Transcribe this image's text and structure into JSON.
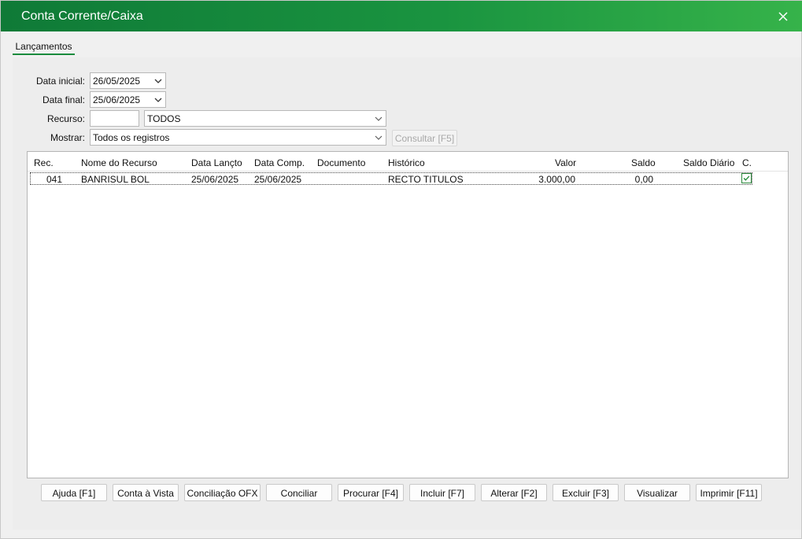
{
  "window": {
    "title": "Conta Corrente/Caixa"
  },
  "tabs": [
    {
      "label": "Lançamentos"
    }
  ],
  "filters": {
    "data_inicial_label": "Data inicial:",
    "data_inicial_value": "26/05/2025",
    "data_final_label": "Data final:",
    "data_final_value": "25/06/2025",
    "recurso_label": "Recurso:",
    "recurso_code": "",
    "recurso_value": "TODOS",
    "mostrar_label": "Mostrar:",
    "mostrar_value": "Todos os registros",
    "consultar_label": "Consultar [F5]"
  },
  "grid": {
    "columns": [
      "Rec.",
      "Nome do Recurso",
      "Data Lançto",
      "Data Comp.",
      "Documento",
      "Histórico",
      "Valor",
      "Saldo",
      "Saldo Diário",
      "C."
    ],
    "rows": [
      {
        "rec": "041",
        "nome": "BANRISUL BOL",
        "data_lancto": "25/06/2025",
        "data_comp": "25/06/2025",
        "documento": "",
        "historico": "RECTO TITULOS",
        "valor": "3.000,00",
        "saldo": "0,00",
        "saldo_diario": "",
        "conciliado": true
      }
    ]
  },
  "footer": {
    "buttons": [
      "Ajuda [F1]",
      "Conta à Vista",
      "Conciliação OFX",
      "Conciliar",
      "Procurar [F4]",
      "Incluir [F7]",
      "Alterar [F2]",
      "Excluir [F3]",
      "Visualizar",
      "Imprimir [F11]"
    ]
  },
  "colors": {
    "title_gradient_start": "#0f7a37",
    "title_gradient_end": "#36b34a",
    "accent": "#1a8b3d"
  }
}
